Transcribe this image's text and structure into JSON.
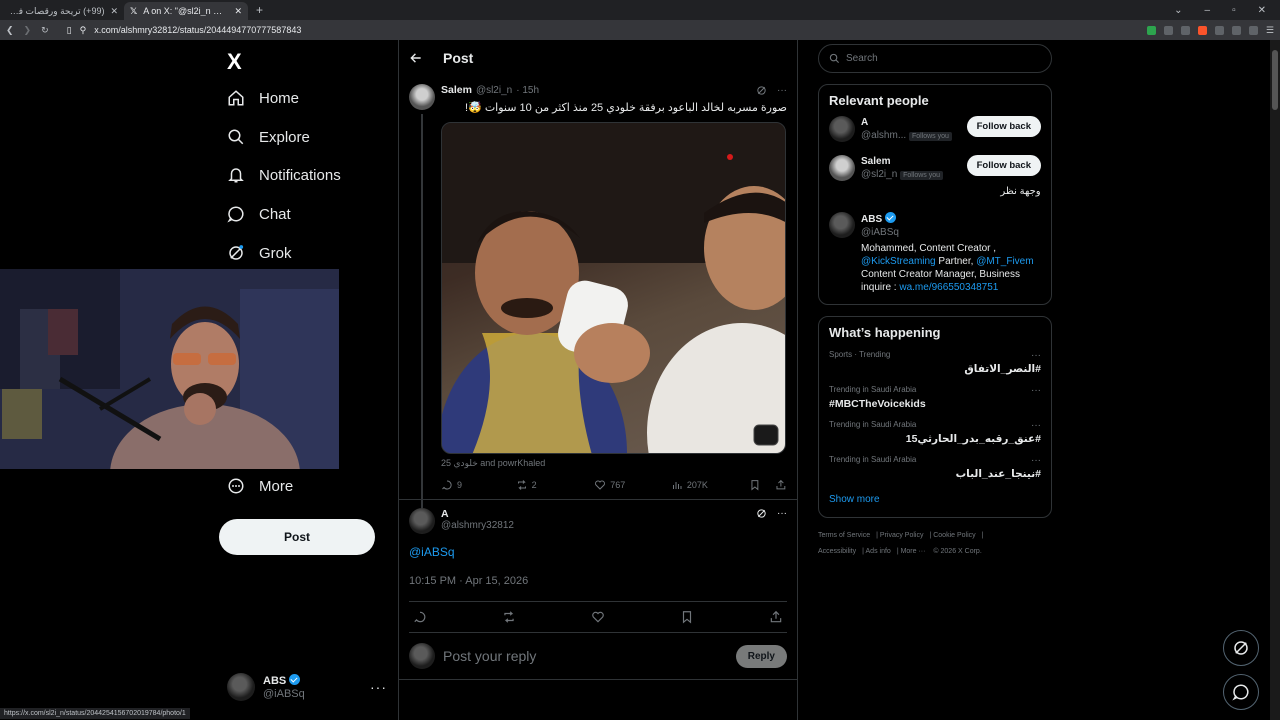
{
  "browser": {
    "tabs": [
      {
        "title": "(99+) تريحة ورقصات فورتنايت القديمة"
      },
      {
        "title": "A on X: \"@sl2i_n @KLOsOIDE25"
      }
    ],
    "url": "x.com/alshmry32812/status/2044494770777587843"
  },
  "nav": {
    "logo": "X",
    "items": [
      {
        "label": "Home",
        "icon": "home-icon"
      },
      {
        "label": "Explore",
        "icon": "search-icon"
      },
      {
        "label": "Notifications",
        "icon": "bell-icon"
      },
      {
        "label": "Chat",
        "icon": "chat-icon"
      },
      {
        "label": "Grok",
        "icon": "grok-icon"
      },
      {
        "label": "More",
        "icon": "more-circle-icon"
      }
    ],
    "post_button": "Post",
    "account": {
      "name": "ABS",
      "handle": "@iABSq"
    }
  },
  "main": {
    "header_title": "Post",
    "original": {
      "name": "Salem",
      "handle": "@sl2i_n",
      "time": "· 15h",
      "text": "صورة مسربه لخالد الباعود برفقة خلودي 25 منذ اكثر من 10 سنوات 🤯!",
      "media_tags": "خلودي 25 and powrKhaled",
      "stats": {
        "replies": "9",
        "reposts": "2",
        "likes": "767",
        "views": "207K"
      }
    },
    "reply": {
      "name": "A",
      "handle": "@alshmry32812",
      "text": "@iABSq",
      "timestamp": "10:15 PM · Apr 15, 2026"
    },
    "compose": {
      "placeholder": "Post your reply",
      "button": "Reply"
    }
  },
  "sidebar": {
    "search_placeholder": "Search",
    "relevant_title": "Relevant people",
    "people": [
      {
        "name": "A",
        "handle": "@alshm...",
        "follows_you": "Follows you",
        "button": "Follow back",
        "bio": ""
      },
      {
        "name": "Salem",
        "handle": "@sl2i_n",
        "follows_you": "Follows you",
        "button": "Follow back",
        "bio": "وجهة نظر"
      },
      {
        "name": "ABS",
        "handle": "@iABSq",
        "bio_1": "Mohammed, Content Creator ,",
        "bio_mention_1": "@KickStreaming",
        "bio_2": " Partner, ",
        "bio_mention_2": "@MT_Fivem",
        "bio_3": "Content Creator Manager, Business inquire : ",
        "bio_link": "wa.me/966550348751"
      }
    ],
    "happening_title": "What’s happening",
    "trends": [
      {
        "meta": "Sports · Trending",
        "name": "#النصر_الاتفاق"
      },
      {
        "meta": "Trending in Saudi Arabia",
        "name": "#MBCTheVoicekids"
      },
      {
        "meta": "Trending in Saudi Arabia",
        "name": "#عنق_رقبه_بدر_الحارثي15"
      },
      {
        "meta": "Trending in Saudi Arabia",
        "name": "#نينجا_عند_الباب"
      }
    ],
    "show_more": "Show more",
    "footer": [
      "Terms of Service",
      "Privacy Policy",
      "Cookie Policy",
      "Accessibility",
      "Ads info",
      "More ···",
      "© 2026 X Corp."
    ]
  },
  "status_url": "https://x.com/sl2i_n/status/2044254156702019784/photo/1",
  "colors": {
    "accent": "#1d9bf0",
    "background": "#000000",
    "border": "#2f3336",
    "muted": "#71767b"
  }
}
